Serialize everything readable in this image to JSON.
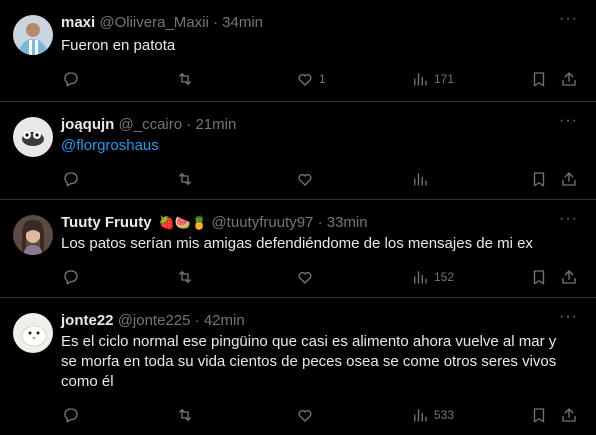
{
  "tweets": [
    {
      "name": "maxi",
      "handle": "@Oliivera_Maxii",
      "time": "34min",
      "text": "Fueron en patota",
      "likes": "1",
      "views": "171"
    },
    {
      "name": "joąqujn",
      "handle": "@_ccairo",
      "time": "21min",
      "text": "@florgroshaus",
      "likes": "",
      "views": ""
    },
    {
      "name": "Tuuty Fruuty",
      "emojis": "🍓🍉🍍",
      "handle": "@tuutyfruuty97",
      "time": "33min",
      "text": "Los patos serían mis amigas defendiéndome de los mensajes de mi ex",
      "likes": "",
      "views": "152"
    },
    {
      "name": "jonte22",
      "handle": "@jonte225",
      "time": "42min",
      "text": "Es el ciclo normal ese pingüino que casi es alimento ahora vuelve al mar y se morfa en toda su vida cientos de peces osea se come otros seres vivos como él",
      "likes": "",
      "views": "533"
    }
  ],
  "ui": {
    "dot_separator": "·",
    "more": "···"
  }
}
